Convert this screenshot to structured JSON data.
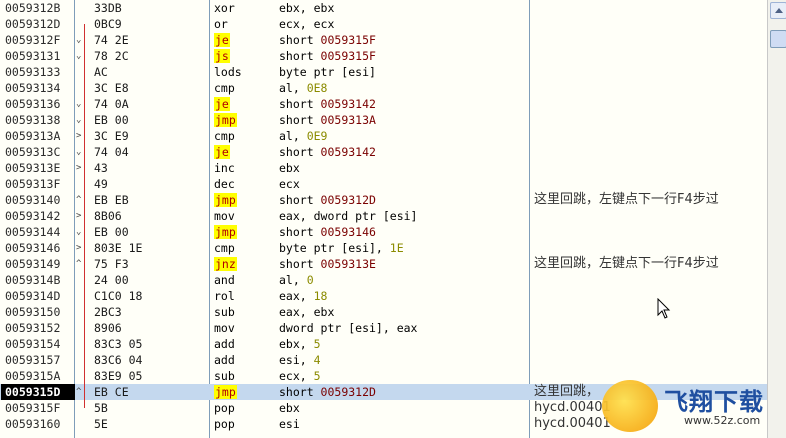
{
  "colors": {
    "jump_highlight": "#ffff00",
    "jump_text": "#b00000",
    "selection": "#c4d8ee",
    "arrow": "#d03030"
  },
  "rows": [
    {
      "addr": "0059312B",
      "mark": "",
      "hex": "33DB",
      "mn": "xor",
      "jump": false,
      "ops": [
        {
          "t": "ebx, ebx",
          "k": ""
        }
      ],
      "cm": ""
    },
    {
      "addr": "0059312D",
      "mark": "",
      "hex": "0BC9",
      "mn": "or",
      "jump": false,
      "ops": [
        {
          "t": "ecx, ecx",
          "k": ""
        }
      ],
      "cm": ""
    },
    {
      "addr": "0059312F",
      "mark": "⌄",
      "hex": "74 2E",
      "mn": "je",
      "jump": true,
      "ops": [
        {
          "t": "short ",
          "k": ""
        },
        {
          "t": "0059315F",
          "k": "tgt"
        }
      ],
      "cm": ""
    },
    {
      "addr": "00593131",
      "mark": "⌄",
      "hex": "78 2C",
      "mn": "js",
      "jump": true,
      "ops": [
        {
          "t": "short ",
          "k": ""
        },
        {
          "t": "0059315F",
          "k": "tgt"
        }
      ],
      "cm": ""
    },
    {
      "addr": "00593133",
      "mark": "",
      "hex": "AC",
      "mn": "lods",
      "jump": false,
      "ops": [
        {
          "t": "byte ptr [esi]",
          "k": ""
        }
      ],
      "cm": ""
    },
    {
      "addr": "00593134",
      "mark": "",
      "hex": "3C E8",
      "mn": "cmp",
      "jump": false,
      "ops": [
        {
          "t": "al, ",
          "k": ""
        },
        {
          "t": "0E8",
          "k": "num"
        }
      ],
      "cm": ""
    },
    {
      "addr": "00593136",
      "mark": "⌄",
      "hex": "74 0A",
      "mn": "je",
      "jump": true,
      "ops": [
        {
          "t": "short ",
          "k": ""
        },
        {
          "t": "00593142",
          "k": "tgt"
        }
      ],
      "cm": ""
    },
    {
      "addr": "00593138",
      "mark": "⌄",
      "hex": "EB 00",
      "mn": "jmp",
      "jump": true,
      "ops": [
        {
          "t": "short ",
          "k": ""
        },
        {
          "t": "0059313A",
          "k": "tgt"
        }
      ],
      "cm": ""
    },
    {
      "addr": "0059313A",
      "mark": ">",
      "hex": "3C E9",
      "mn": "cmp",
      "jump": false,
      "ops": [
        {
          "t": "al, ",
          "k": ""
        },
        {
          "t": "0E9",
          "k": "num"
        }
      ],
      "cm": ""
    },
    {
      "addr": "0059313C",
      "mark": "⌄",
      "hex": "74 04",
      "mn": "je",
      "jump": true,
      "ops": [
        {
          "t": "short ",
          "k": ""
        },
        {
          "t": "00593142",
          "k": "tgt"
        }
      ],
      "cm": ""
    },
    {
      "addr": "0059313E",
      "mark": ">",
      "hex": "43",
      "mn": "inc",
      "jump": false,
      "ops": [
        {
          "t": "ebx",
          "k": ""
        }
      ],
      "cm": ""
    },
    {
      "addr": "0059313F",
      "mark": "",
      "hex": "49",
      "mn": "dec",
      "jump": false,
      "ops": [
        {
          "t": "ecx",
          "k": ""
        }
      ],
      "cm": ""
    },
    {
      "addr": "00593140",
      "mark": "^",
      "hex": "EB EB",
      "mn": "jmp",
      "jump": true,
      "ops": [
        {
          "t": "short ",
          "k": ""
        },
        {
          "t": "0059312D",
          "k": "tgt"
        }
      ],
      "cm": "这里回跳，左键点下一行F4步过"
    },
    {
      "addr": "00593142",
      "mark": ">",
      "hex": "8B06",
      "mn": "mov",
      "jump": false,
      "ops": [
        {
          "t": "eax, dword ptr [esi]",
          "k": ""
        }
      ],
      "cm": ""
    },
    {
      "addr": "00593144",
      "mark": "⌄",
      "hex": "EB 00",
      "mn": "jmp",
      "jump": true,
      "ops": [
        {
          "t": "short ",
          "k": ""
        },
        {
          "t": "00593146",
          "k": "tgt"
        }
      ],
      "cm": ""
    },
    {
      "addr": "00593146",
      "mark": ">",
      "hex": "803E 1E",
      "mn": "cmp",
      "jump": false,
      "ops": [
        {
          "t": "byte ptr [esi], ",
          "k": ""
        },
        {
          "t": "1E",
          "k": "num"
        }
      ],
      "cm": ""
    },
    {
      "addr": "00593149",
      "mark": "^",
      "hex": "75 F3",
      "mn": "jnz",
      "jump": true,
      "ops": [
        {
          "t": "short ",
          "k": ""
        },
        {
          "t": "0059313E",
          "k": "tgt"
        }
      ],
      "cm": "这里回跳，左键点下一行F4步过"
    },
    {
      "addr": "0059314B",
      "mark": "",
      "hex": "24 00",
      "mn": "and",
      "jump": false,
      "ops": [
        {
          "t": "al, ",
          "k": ""
        },
        {
          "t": "0",
          "k": "num"
        }
      ],
      "cm": ""
    },
    {
      "addr": "0059314D",
      "mark": "",
      "hex": "C1C0 18",
      "mn": "rol",
      "jump": false,
      "ops": [
        {
          "t": "eax, ",
          "k": ""
        },
        {
          "t": "18",
          "k": "num"
        }
      ],
      "cm": ""
    },
    {
      "addr": "00593150",
      "mark": "",
      "hex": "2BC3",
      "mn": "sub",
      "jump": false,
      "ops": [
        {
          "t": "eax, ebx",
          "k": ""
        }
      ],
      "cm": ""
    },
    {
      "addr": "00593152",
      "mark": "",
      "hex": "8906",
      "mn": "mov",
      "jump": false,
      "ops": [
        {
          "t": "dword ptr [esi], eax",
          "k": ""
        }
      ],
      "cm": ""
    },
    {
      "addr": "00593154",
      "mark": "",
      "hex": "83C3 05",
      "mn": "add",
      "jump": false,
      "ops": [
        {
          "t": "ebx, ",
          "k": ""
        },
        {
          "t": "5",
          "k": "num"
        }
      ],
      "cm": ""
    },
    {
      "addr": "00593157",
      "mark": "",
      "hex": "83C6 04",
      "mn": "add",
      "jump": false,
      "ops": [
        {
          "t": "esi, ",
          "k": ""
        },
        {
          "t": "4",
          "k": "num"
        }
      ],
      "cm": ""
    },
    {
      "addr": "0059315A",
      "mark": "",
      "hex": "83E9 05",
      "mn": "sub",
      "jump": false,
      "ops": [
        {
          "t": "ecx, ",
          "k": ""
        },
        {
          "t": "5",
          "k": "num"
        }
      ],
      "cm": ""
    },
    {
      "addr": "0059315D",
      "mark": "^",
      "hex": "EB CE",
      "mn": "jmp",
      "jump": true,
      "selected": true,
      "ops": [
        {
          "t": "short ",
          "k": ""
        },
        {
          "t": "0059312D",
          "k": "tgt"
        }
      ],
      "cm": "这里回跳，"
    },
    {
      "addr": "0059315F",
      "mark": "",
      "hex": "5B",
      "mn": "pop",
      "jump": false,
      "ops": [
        {
          "t": "ebx",
          "k": ""
        }
      ],
      "cm": "hycd.00401"
    },
    {
      "addr": "00593160",
      "mark": "",
      "hex": "5E",
      "mn": "pop",
      "jump": false,
      "ops": [
        {
          "t": "esi",
          "k": ""
        }
      ],
      "cm": "hycd.00401"
    }
  ],
  "watermark": {
    "title": "飞翔下载",
    "url": "www.52z.com"
  },
  "scrollbar": {
    "up_icon": "arrow-up-icon"
  }
}
